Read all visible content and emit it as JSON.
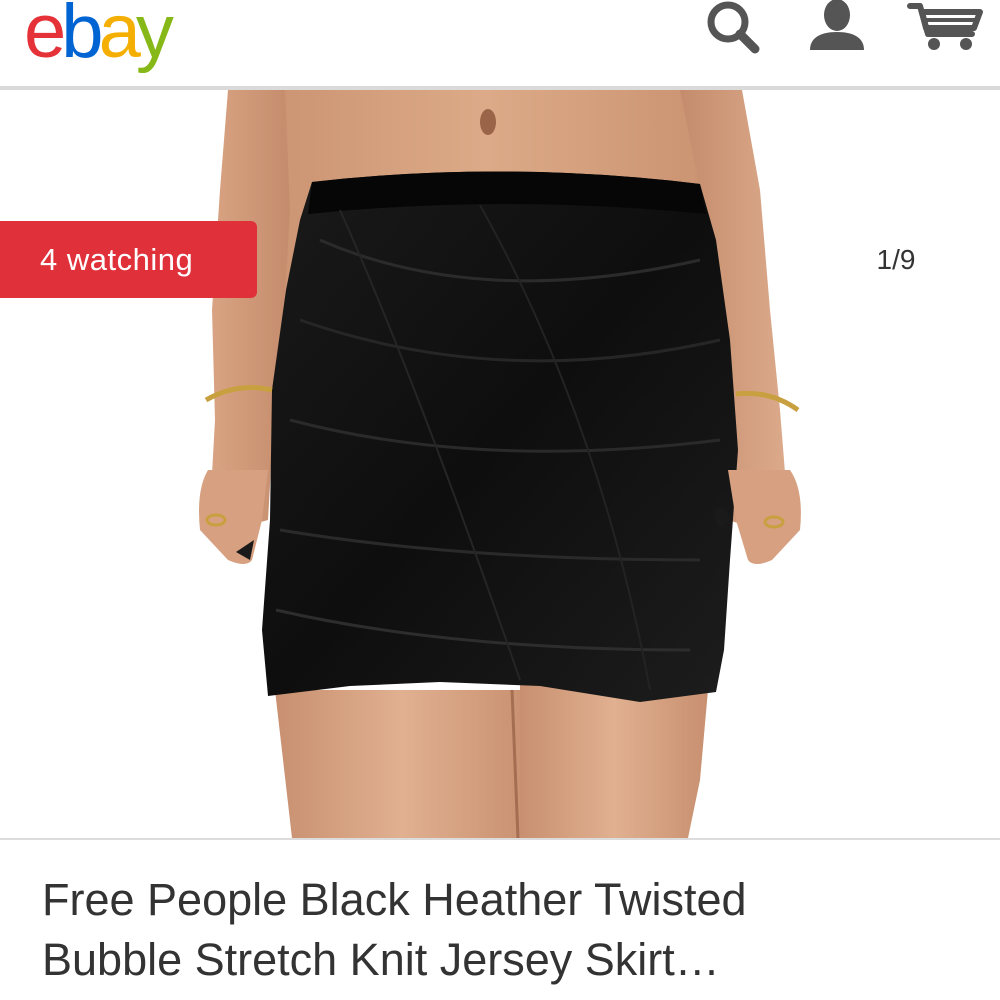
{
  "header": {
    "logo_letters": [
      "e",
      "b",
      "a",
      "y"
    ],
    "logo_colors": [
      "#e53238",
      "#0064d2",
      "#f5af02",
      "#86b817"
    ],
    "icons": [
      "search-icon",
      "account-icon",
      "cart-icon"
    ],
    "icon_color": "#555555"
  },
  "gallery": {
    "watch_badge": "4 watching",
    "counter": "1/9",
    "badge_color": "#e0303a"
  },
  "item": {
    "title_line1": "Free People Black Heather Twisted",
    "title_line2": "Bubble Stretch Knit Jersey Skirt…"
  }
}
